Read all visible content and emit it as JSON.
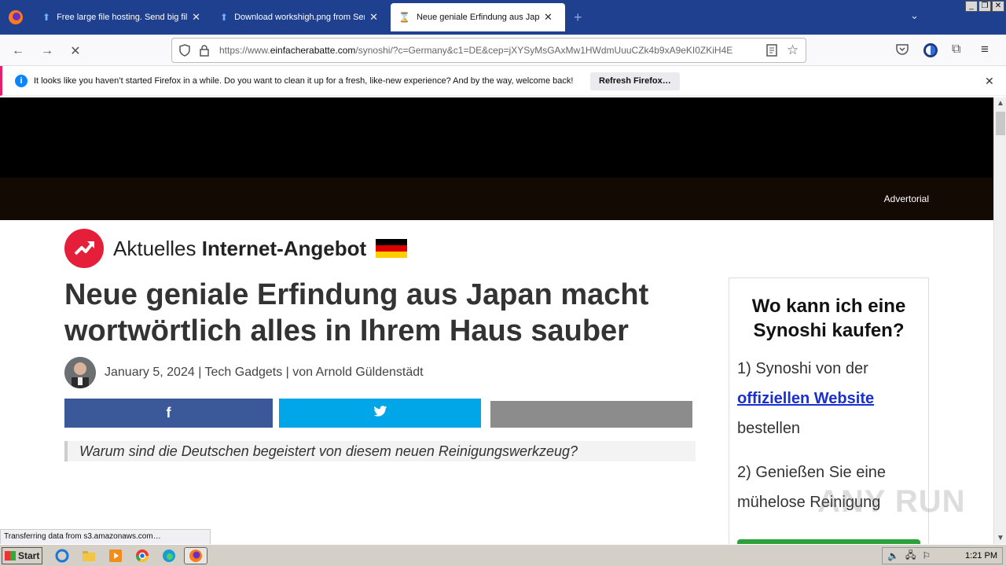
{
  "browser": {
    "tabs": [
      {
        "title": "Free large file hosting. Send big fil"
      },
      {
        "title": "Download workshigh.png from Sen"
      },
      {
        "title": "Neue geniale Erfindung aus Japan"
      }
    ],
    "new_tab_symbol": "+",
    "url_prefix": "https://www.",
    "url_domain": "einfacherabatte.com",
    "url_rest": "/synoshi/?c=Germany&c1=DE&cep=jXYSyMsGAxMw1HWdmUuuCZk4b9xA9eKI0ZKiH4E",
    "notification": {
      "text": "It looks like you haven’t started Firefox in a while. Do you want to clean it up for a fresh, like-new experience? And by the way, welcome back!",
      "button": "Refresh Firefox…"
    },
    "status_text": "Transferring data from s3.amazonaws.com…"
  },
  "page": {
    "advertorial_label": "Advertorial",
    "brand_light": "Aktuelles",
    "brand_bold": "Internet-Angebot",
    "headline": "Neue geniale Erfindung aus Japan macht wortwörtlich alles in Ihrem Haus sauber",
    "byline": "January 5, 2024 | Tech Gadgets | von Arnold Güldenstädt",
    "share_facebook": "f",
    "quote": "Warum sind die Deutschen begeistert von diesem neuen Reinigungswerkzeug?",
    "sidebar": {
      "title": "Wo kann ich eine Synoshi kaufen?",
      "step1_before": "1) Synoshi von der",
      "step1_link": "offiziellen Website",
      "step1_after": "bestellen",
      "step2": "2) Genießen Sie eine mühelose Reinigung"
    },
    "watermark": "ANY RUN"
  },
  "taskbar": {
    "start_label": "Start",
    "clock": "1:21 PM"
  },
  "colors": {
    "facebook": "#3b5998",
    "twitter": "#00a6e8",
    "grey_share": "#8c8c8c",
    "accent_red": "#e51f3a"
  },
  "icons": [
    "firefox-icon",
    "upload-icon",
    "hourglass-icon",
    "close-icon",
    "back-icon",
    "forward-icon",
    "stop-icon",
    "shield-icon",
    "lock-icon",
    "reader-icon",
    "star-icon",
    "pocket-icon",
    "account-icon",
    "extensions-icon",
    "menu-icon",
    "info-icon",
    "twitter-icon"
  ]
}
